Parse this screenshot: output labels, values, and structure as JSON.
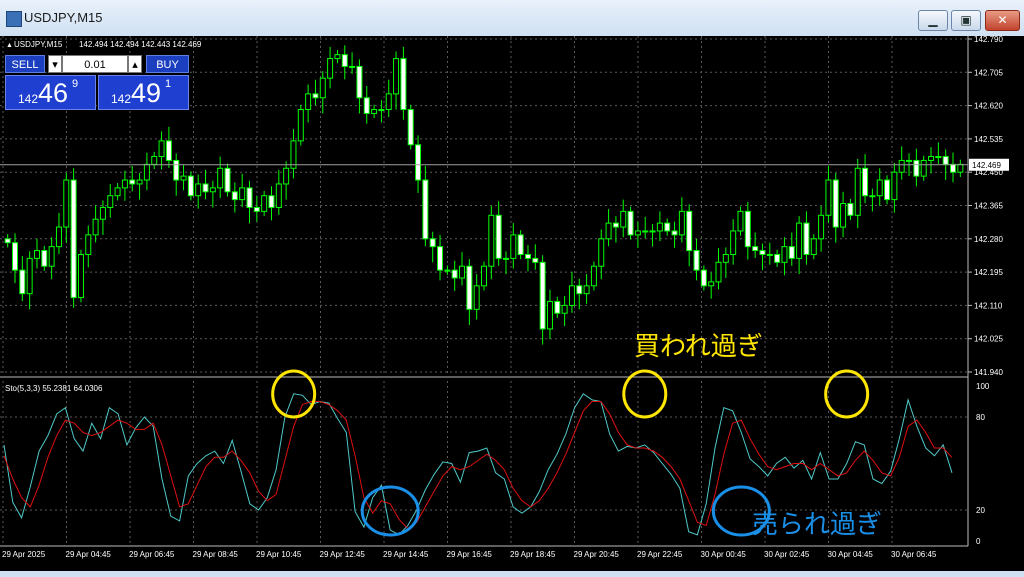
{
  "window": {
    "title": "USDJPY,M15",
    "buttons": {
      "minimize": "▁",
      "restore": "▣",
      "close": "✕"
    }
  },
  "header": {
    "symbol_label": "USDJPY,M15",
    "ohlc": "142.494 142.494 142.443 142.469"
  },
  "trade_panel": {
    "sell_label": "SELL",
    "buy_label": "BUY",
    "lot_value": "0.01",
    "sell_price": {
      "prefix": "142",
      "big": "46",
      "sup": "9"
    },
    "buy_price": {
      "prefix": "142",
      "big": "49",
      "sup": "1"
    }
  },
  "indicator": {
    "label": "Sto(5,3,3) 55.2381 64.0306",
    "levels": [
      "100",
      "80",
      "20",
      "0"
    ]
  },
  "annotations": {
    "overbought": "買われ過ぎ",
    "oversold": "売られ過ぎ"
  },
  "colors": {
    "background": "#000000",
    "candle": "#00ff00",
    "main_line": "#4fc9c9",
    "signal_line": "#e01010",
    "overbought_circle": "#ffe600",
    "oversold_circle": "#1a8fe8"
  },
  "chart_data": [
    {
      "type": "candlestick",
      "title": "USDJPY,M15",
      "ylim": [
        141.94,
        142.79
      ],
      "yticks": [
        "142.790",
        "142.705",
        "142.620",
        "142.535",
        "142.450",
        "142.365",
        "142.280",
        "142.195",
        "142.110",
        "142.025",
        "141.940"
      ],
      "current_price": "142.469",
      "xticks": [
        "29 Apr 2025",
        "29 Apr 04:45",
        "29 Apr 06:45",
        "29 Apr 08:45",
        "29 Apr 10:45",
        "29 Apr 12:45",
        "29 Apr 14:45",
        "29 Apr 16:45",
        "29 Apr 18:45",
        "29 Apr 20:45",
        "29 Apr 22:45",
        "30 Apr 00:45",
        "30 Apr 02:45",
        "30 Apr 04:45",
        "30 Apr 06:45"
      ],
      "close": [
        142.27,
        142.2,
        142.14,
        142.23,
        142.25,
        142.21,
        142.26,
        142.31,
        142.43,
        142.13,
        142.24,
        142.29,
        142.33,
        142.36,
        142.39,
        142.41,
        142.43,
        142.42,
        142.43,
        142.47,
        142.49,
        142.53,
        142.48,
        142.43,
        142.44,
        142.39,
        142.42,
        142.4,
        142.41,
        142.46,
        142.4,
        142.38,
        142.41,
        142.36,
        142.35,
        142.39,
        142.36,
        142.42,
        142.46,
        142.53,
        142.61,
        142.65,
        142.64,
        142.69,
        142.74,
        142.75,
        142.72,
        142.72,
        142.64,
        142.6,
        142.61,
        142.61,
        142.65,
        142.74,
        142.61,
        142.52,
        142.43,
        142.28,
        142.26,
        142.2,
        142.2,
        142.18,
        142.21,
        142.1,
        142.16,
        142.21,
        142.34,
        142.23,
        142.23,
        142.29,
        142.24,
        142.23,
        142.22,
        142.05,
        142.12,
        142.09,
        142.11,
        142.16,
        142.14,
        142.16,
        142.21,
        142.28,
        142.32,
        142.31,
        142.35,
        142.29,
        142.3,
        142.3,
        142.3,
        142.32,
        142.3,
        142.29,
        142.35,
        142.25,
        142.2,
        142.16,
        142.17,
        142.22,
        142.24,
        142.3,
        142.35,
        142.26,
        142.25,
        142.24,
        142.24,
        142.22,
        142.26,
        142.23,
        142.32,
        142.24,
        142.28,
        142.34,
        142.43,
        142.31,
        142.37,
        142.34,
        142.46,
        142.39,
        142.39,
        142.43,
        142.38,
        142.45,
        142.48,
        142.48,
        142.44,
        142.48,
        142.49,
        142.49,
        142.47,
        142.45,
        142.47
      ]
    },
    {
      "type": "line",
      "title": "Sto(5,3,3) 55.2381 64.0306",
      "ylim": [
        0,
        100
      ],
      "yticks": [
        100,
        80,
        20,
        0
      ],
      "series": [
        {
          "name": "Main",
          "values": [
            62,
            25,
            15,
            35,
            58,
            68,
            82,
            86,
            66,
            58,
            76,
            66,
            86,
            82,
            62,
            73,
            80,
            74,
            40,
            16,
            13,
            42,
            50,
            55,
            58,
            50,
            65,
            45,
            24,
            20,
            28,
            46,
            80,
            95,
            94,
            88,
            90,
            89,
            79,
            70,
            19,
            9,
            28,
            36,
            7,
            4,
            10,
            20,
            33,
            43,
            51,
            50,
            38,
            57,
            58,
            60,
            44,
            40,
            22,
            18,
            22,
            32,
            46,
            56,
            69,
            86,
            95,
            91,
            90,
            69,
            58,
            61,
            60,
            62,
            57,
            50,
            43,
            34,
            6,
            4,
            24,
            60,
            86,
            84,
            70,
            53,
            48,
            42,
            50,
            54,
            47,
            52,
            40,
            57,
            40,
            40,
            50,
            64,
            62,
            40,
            37,
            45,
            66,
            91,
            74,
            60,
            55,
            62,
            44
          ]
        },
        {
          "name": "Signal",
          "values": [
            55,
            40,
            28,
            22,
            36,
            54,
            68,
            78,
            76,
            70,
            68,
            70,
            74,
            78,
            76,
            72,
            72,
            76,
            62,
            42,
            22,
            24,
            36,
            48,
            54,
            54,
            58,
            52,
            44,
            32,
            26,
            30,
            52,
            74,
            88,
            90,
            90,
            88,
            84,
            78,
            55,
            28,
            18,
            26,
            24,
            14,
            8,
            12,
            22,
            32,
            42,
            48,
            46,
            48,
            52,
            56,
            52,
            46,
            34,
            26,
            22,
            26,
            34,
            44,
            56,
            70,
            84,
            90,
            90,
            82,
            70,
            62,
            60,
            60,
            58,
            54,
            48,
            40,
            26,
            12,
            10,
            30,
            56,
            76,
            78,
            66,
            56,
            48,
            46,
            48,
            50,
            50,
            46,
            50,
            46,
            42,
            44,
            52,
            58,
            52,
            44,
            42,
            54,
            74,
            78,
            70,
            60,
            60,
            54
          ]
        }
      ],
      "markers": [
        {
          "label": "overbought",
          "x_index": 33
        },
        {
          "label": "overbought",
          "x_index": 73
        },
        {
          "label": "overbought",
          "x_index": 96
        },
        {
          "label": "oversold",
          "x_index": 44
        },
        {
          "label": "oversold",
          "x_index": 84
        }
      ]
    }
  ]
}
